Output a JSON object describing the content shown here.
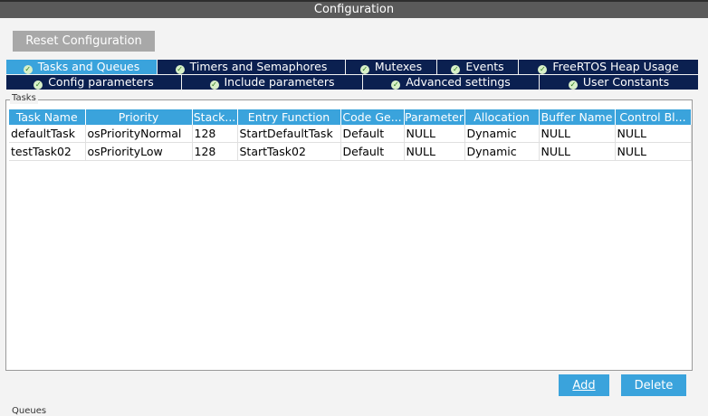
{
  "window": {
    "title": "Configuration"
  },
  "toolbar": {
    "reset_label": "Reset Configuration"
  },
  "tabs_row1": [
    {
      "label": "Tasks and Queues",
      "active": true
    },
    {
      "label": "Timers and Semaphores",
      "active": false
    },
    {
      "label": "Mutexes",
      "active": false
    },
    {
      "label": "Events",
      "active": false
    },
    {
      "label": "FreeRTOS Heap Usage",
      "active": false
    }
  ],
  "tabs_row2": [
    {
      "label": "Config parameters",
      "active": false
    },
    {
      "label": "Include parameters",
      "active": false
    },
    {
      "label": "Advanced settings",
      "active": false
    },
    {
      "label": "User Constants",
      "active": false
    }
  ],
  "tasks": {
    "group_label": "Tasks",
    "columns": [
      "Task Name",
      "Priority",
      "Stack...",
      "Entry Function",
      "Code Ge...",
      "Parameter",
      "Allocation",
      "Buffer Name",
      "Control Bl..."
    ],
    "rows": [
      [
        "defaultTask",
        "osPriorityNormal",
        "128",
        "StartDefaultTask",
        "Default",
        "NULL",
        "Dynamic",
        "NULL",
        "NULL"
      ],
      [
        "testTask02",
        "osPriorityLow",
        "128",
        "StartTask02",
        "Default",
        "NULL",
        "Dynamic",
        "NULL",
        "NULL"
      ]
    ],
    "add_label": "Add",
    "delete_label": "Delete"
  },
  "queues": {
    "group_label": "Queues"
  },
  "colors": {
    "tab_active": "#3aa3dc",
    "tab_inactive": "#0b2050",
    "header": "#3aa3dc",
    "titlebar": "#5a5a5a"
  },
  "icons": {
    "tab_status": "check-circle-icon"
  }
}
